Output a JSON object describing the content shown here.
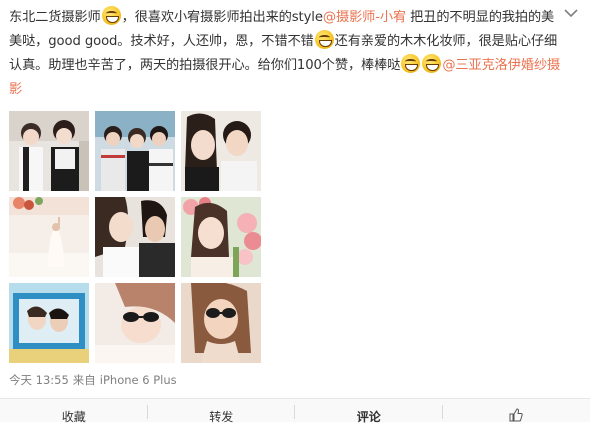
{
  "post": {
    "segments": [
      {
        "type": "text",
        "text": "东北二货摄影师"
      },
      {
        "type": "emoji",
        "name": "grin-emoji"
      },
      {
        "type": "text",
        "text": "，很喜欢小宥摄影师拍出来的style"
      },
      {
        "type": "mention",
        "text": "@摄影师-小宥"
      },
      {
        "type": "text",
        "text": " 把丑的不明显的我拍的美美哒，good good。技术好，人还帅，恩，不错不错"
      },
      {
        "type": "emoji",
        "name": "smirk-emoji"
      },
      {
        "type": "text",
        "text": "还有亲爱的木木化妆师，很是贴心仔细认真。助理也辛苦了，两天的拍摄很开心。给你们100个赞，棒棒哒"
      },
      {
        "type": "emoji",
        "name": "grin-emoji"
      },
      {
        "type": "emoji",
        "name": "grin-emoji"
      },
      {
        "type": "mention",
        "text": "@三亚克洛伊婚纱摄影"
      }
    ]
  },
  "photos": [
    {
      "name": "photo-1",
      "scene": "couple-white-shirts"
    },
    {
      "name": "photo-2",
      "scene": "group-striped-outfits"
    },
    {
      "name": "photo-3",
      "scene": "two-friends-selfie"
    },
    {
      "name": "photo-4",
      "scene": "bride-by-window-flowers"
    },
    {
      "name": "photo-5",
      "scene": "couple-embrace-closeup"
    },
    {
      "name": "photo-6",
      "scene": "bride-with-flowers"
    },
    {
      "name": "photo-7",
      "scene": "framed-couple-blue"
    },
    {
      "name": "photo-8",
      "scene": "bride-sunglasses"
    },
    {
      "name": "photo-9",
      "scene": "bride-sunglasses-portrait"
    }
  ],
  "meta": {
    "time": "今天 13:55",
    "source_prefix": "来自",
    "device": "iPhone 6 Plus"
  },
  "actions": {
    "favorite": "收藏",
    "repost": "转发",
    "comment": "评论",
    "like_icon": "thumbs-up-icon"
  },
  "colors": {
    "mention": "#eb7350",
    "meta": "#808080",
    "action_bar": "#f9f9f9"
  }
}
